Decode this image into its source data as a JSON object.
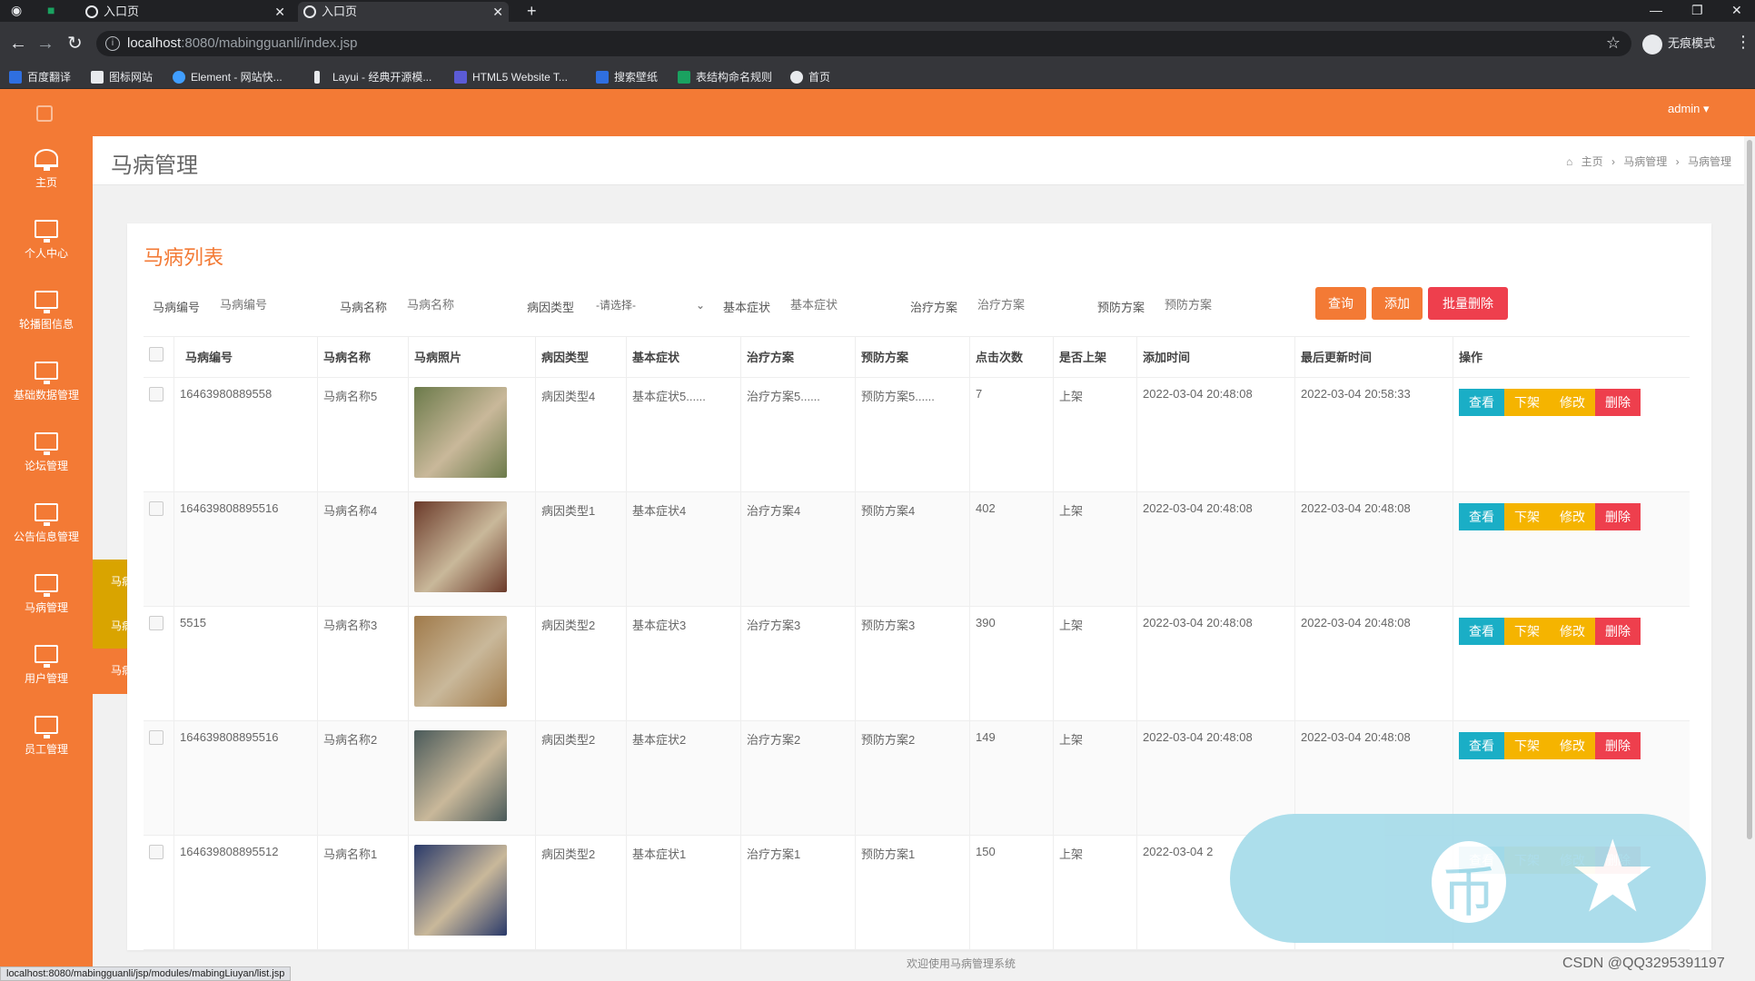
{
  "browser": {
    "tabs": [
      {
        "label": "入口页",
        "active": false
      },
      {
        "label": "入口页",
        "active": true
      }
    ],
    "url_host": "localhost",
    "url_rest": ":8080/mabingguanli/index.jsp",
    "profile_label": "无痕模式",
    "bookmarks": [
      {
        "label": "百度翻译",
        "color": "#2f6fe0"
      },
      {
        "label": "图标网站",
        "color": "#e8eaed"
      },
      {
        "label": "Element - 网站快...",
        "color": "#409eff"
      },
      {
        "label": "Layui - 经典开源模...",
        "color": "#e8eaed"
      },
      {
        "label": "HTML5 Website T...",
        "color": "#5b5bd6"
      },
      {
        "label": "搜索壁纸",
        "color": "#2f6fe0"
      },
      {
        "label": "表结构命名规则",
        "color": "#1aa260"
      },
      {
        "label": "首页",
        "color": "#e8eaed"
      }
    ]
  },
  "header": {
    "user": "admin ▾"
  },
  "sidebar": {
    "items": [
      {
        "label": "主页",
        "icon": "dashboard-icon"
      },
      {
        "label": "个人中心",
        "icon": "monitor-icon"
      },
      {
        "label": "轮播图信息",
        "icon": "monitor-icon"
      },
      {
        "label": "基础数据管理",
        "icon": "monitor-icon"
      },
      {
        "label": "论坛管理",
        "icon": "monitor-icon"
      },
      {
        "label": "公告信息管理",
        "icon": "monitor-icon"
      },
      {
        "label": "马病管理",
        "icon": "monitor-icon"
      },
      {
        "label": "用户管理",
        "icon": "monitor-icon"
      },
      {
        "label": "员工管理",
        "icon": "monitor-icon"
      }
    ],
    "submenu": [
      {
        "label": "马病管理"
      },
      {
        "label": "马病留言管理"
      },
      {
        "label": "马病收藏管理"
      }
    ]
  },
  "page": {
    "title": "马病管理",
    "breadcrumb": [
      "主页",
      "马病管理",
      "马病管理"
    ]
  },
  "card": {
    "title": "马病列表",
    "filters": [
      {
        "label": "马病编号",
        "placeholder": "马病编号"
      },
      {
        "label": "马病名称",
        "placeholder": "马病名称"
      },
      {
        "label": "病因类型",
        "placeholder": "-请选择-"
      },
      {
        "label": "基本症状",
        "placeholder": "基本症状"
      },
      {
        "label": "治疗方案",
        "placeholder": "治疗方案"
      },
      {
        "label": "预防方案",
        "placeholder": "预防方案"
      }
    ],
    "buttons": {
      "search": "查询",
      "add": "添加",
      "batch_delete": "批量删除"
    }
  },
  "table": {
    "headers": [
      "马病编号",
      "马病名称",
      "马病照片",
      "病因类型",
      "基本症状",
      "治疗方案",
      "预防方案",
      "点击次数",
      "是否上架",
      "添加时间",
      "最后更新时间",
      "操作"
    ],
    "rows": [
      {
        "id": "16463980889558",
        "name": "马病名称5",
        "type": "病因类型4",
        "symptom": "基本症状5......",
        "treat": "治疗方案5......",
        "prevent": "预防方案5......",
        "clicks": "7",
        "status": "上架",
        "added": "2022-03-04 20:48:08",
        "updated": "2022-03-04 20:58:33",
        "photo": "#6b7a4a"
      },
      {
        "id": "164639808895516",
        "name": "马病名称4",
        "type": "病因类型1",
        "symptom": "基本症状4",
        "treat": "治疗方案4",
        "prevent": "预防方案4",
        "clicks": "402",
        "status": "上架",
        "added": "2022-03-04 20:48:08",
        "updated": "2022-03-04 20:48:08",
        "photo": "#6b3a2a"
      },
      {
        "id": "5515",
        "name": "马病名称3",
        "type": "病因类型2",
        "symptom": "基本症状3",
        "treat": "治疗方案3",
        "prevent": "预防方案3",
        "clicks": "390",
        "status": "上架",
        "added": "2022-03-04 20:48:08",
        "updated": "2022-03-04 20:48:08",
        "photo": "#a07a4a"
      },
      {
        "id": "164639808895516",
        "name": "马病名称2",
        "type": "病因类型2",
        "symptom": "基本症状2",
        "treat": "治疗方案2",
        "prevent": "预防方案2",
        "clicks": "149",
        "status": "上架",
        "added": "2022-03-04 20:48:08",
        "updated": "2022-03-04 20:48:08",
        "photo": "#4a5a5a"
      },
      {
        "id": "164639808895512",
        "name": "马病名称1",
        "type": "病因类型2",
        "symptom": "基本症状1",
        "treat": "治疗方案1",
        "prevent": "预防方案1",
        "clicks": "150",
        "status": "上架",
        "added": "2022-03-04 2",
        "updated": "",
        "photo": "#2a3a6a"
      }
    ],
    "actions": {
      "view": "查看",
      "unpublish": "下架",
      "edit": "修改",
      "delete": "删除"
    }
  },
  "footer": {
    "text": "欢迎使用马病管理系统",
    "status_url": "localhost:8080/mabingguanli/jsp/modules/mabingLiuyan/list.jsp",
    "watermark": "CSDN @QQ3295391197"
  },
  "colors": {
    "brand": "#f37a35",
    "view": "#1aaec6",
    "unpublish": "#f5b400",
    "edit": "#f5b400",
    "delete": "#ee3f4d",
    "submenu_active": "#d9a400"
  }
}
